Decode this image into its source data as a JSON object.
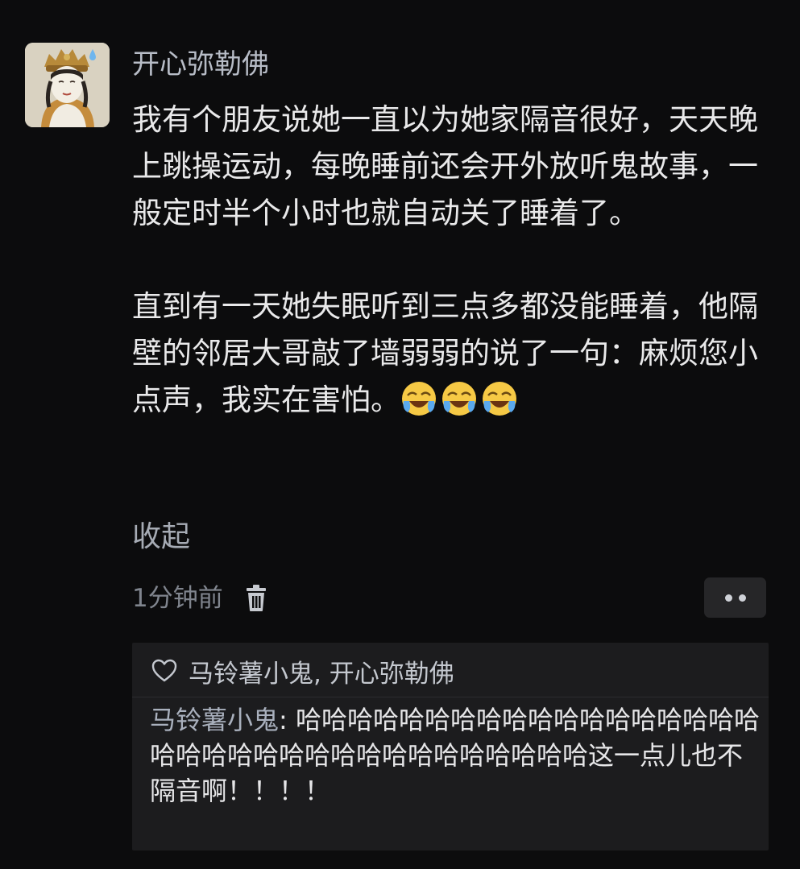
{
  "post": {
    "username": "开心弥勒佛",
    "paragraph1": "我有个朋友说她一直以为她家隔音很好，天天晚上跳操运动，每晚睡前还会开外放听鬼故事，一般定时半个小时也就自动关了睡着了。",
    "paragraph2": "直到有一天她失眠听到三点多都没能睡着，他隔壁的邻居大哥敲了墙弱弱的说了一句：麻烦您小点声，我实在害怕。",
    "emojis": [
      "crying-laughing-emoji",
      "crying-laughing-emoji",
      "crying-laughing-emoji"
    ],
    "collapse_label": "收起",
    "timestamp": "1分钟前"
  },
  "reply": {
    "likers": "马铃薯小鬼, 开心弥勒佛",
    "author": "马铃薯小鬼",
    "separator": ": ",
    "text": "哈哈哈哈哈哈哈哈哈哈哈哈哈哈哈哈哈哈哈哈哈哈哈哈哈哈哈哈哈哈哈哈哈哈哈这一点儿也不隔音啊！！！！"
  },
  "icons": {
    "trash": "trash-icon",
    "more": "more-dots-icon",
    "heart": "heart-outline-icon"
  },
  "colors": {
    "background": "#0c0c0d",
    "text": "#e9e9ea",
    "username": "#b7bcc6",
    "muted": "#80858e",
    "reply_box": "#1c1c1e"
  }
}
